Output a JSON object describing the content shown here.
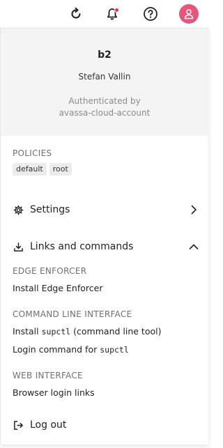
{
  "topbar": {
    "icons": [
      "refresh-icon",
      "bell-icon",
      "help-icon",
      "user-icon"
    ],
    "accent": "#e8557a",
    "notification_dot": "#e8334f"
  },
  "profile": {
    "username": "b2",
    "fullname": "Stefan Vallin",
    "auth_line1": "Authenticated by",
    "auth_line2": "avassa-cloud-account"
  },
  "policies": {
    "heading": "POLICIES",
    "chips": [
      "default",
      "root"
    ]
  },
  "settings": {
    "label": "Settings"
  },
  "links": {
    "label": "Links and commands",
    "edge_heading": "EDGE ENFORCER",
    "edge_install": "Install Edge Enforcer",
    "cli_heading": "COMMAND LINE INTERFACE",
    "cli_install_pre": "Install",
    "cli_install_code": "supctl",
    "cli_install_post": "(command line tool)",
    "cli_login_pre": "Login command for",
    "cli_login_code": "supctl",
    "web_heading": "WEB INTERFACE",
    "web_links": "Browser login links"
  },
  "logout": {
    "label": "Log out"
  }
}
